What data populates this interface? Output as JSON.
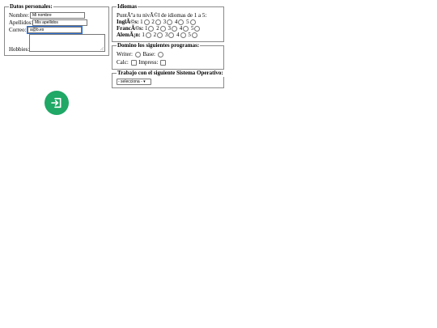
{
  "personal": {
    "legend": "Datos personales:",
    "name_label": "Nombre:",
    "name_value": "Mi nombre",
    "surname_label": "Apellidos:",
    "surname_value": "Mis apellidos",
    "email_label": "Correo:",
    "email_value": "a@b.es",
    "hobbies_label": "Hobbies:"
  },
  "languages": {
    "legend": "Idiomas",
    "intro": "PuntÃºa tu nivÃ©l de idiomas de 1 a 5:",
    "rows": [
      {
        "label": "InglÃ©s:",
        "options": [
          "1",
          "2",
          "3",
          "4",
          "5"
        ]
      },
      {
        "label": "FrancÃ©s:",
        "options": [
          "1",
          "2",
          "3",
          "4",
          "5"
        ]
      },
      {
        "label": "AlemÃ¡n:",
        "options": [
          "1",
          "2",
          "3",
          "4",
          "5"
        ]
      }
    ]
  },
  "programs": {
    "legend": "Domino los siguientes programas:",
    "items": [
      "Writer:",
      "Base:",
      "Calc:",
      "Impress:"
    ]
  },
  "os": {
    "legend": "Trabajo con el siguiente Sistema Operativo:",
    "selected": "- selecciona -"
  },
  "fab": {
    "icon": "login-icon",
    "color": "#1fa866"
  }
}
